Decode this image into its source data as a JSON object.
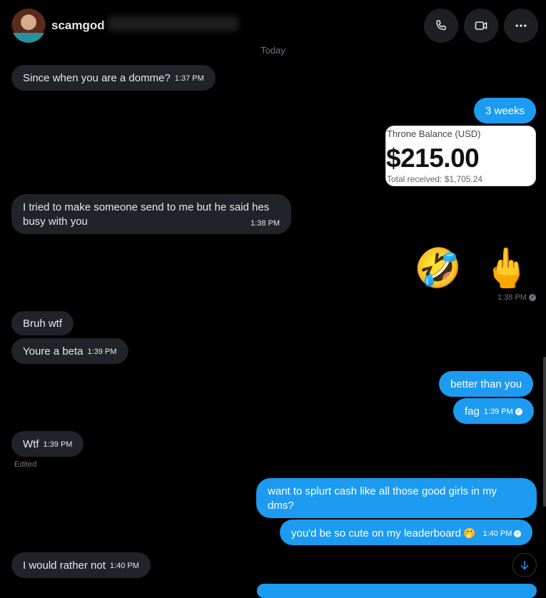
{
  "header": {
    "contact_name": "scamgod",
    "icons": [
      "phone-icon",
      "video-camera-icon",
      "more-icon"
    ]
  },
  "date_separator": "Today",
  "messages": {
    "m1": {
      "text": "Since when you are a domme?",
      "time": "1:37 PM"
    },
    "m2": {
      "text": "3 weeks"
    },
    "card": {
      "title": "Throne Balance (USD)",
      "amount": "$215.00",
      "total": "Total received: $1,705.24"
    },
    "m3": {
      "line1": "I tried to make someone send to me but he said hes",
      "line2": "busy with you",
      "time": "1:38 PM"
    },
    "emojis": {
      "e1": "🤣",
      "e2": "🖕",
      "time": "1:38 PM"
    },
    "m4": {
      "text": "Bruh wtf"
    },
    "m5": {
      "text": "Youre a beta",
      "time": "1:39 PM"
    },
    "m6": {
      "text": "better than you"
    },
    "m7": {
      "text": "fag",
      "time": "1:39 PM"
    },
    "m8": {
      "text": "Wtf",
      "time": "1:39 PM",
      "status": "Edited"
    },
    "m9": {
      "line1": "want to splurt cash like all those good girls in my",
      "line2": "dms?"
    },
    "m10": {
      "text": "you'd be so cute on my leaderboard",
      "emoji": "🤭",
      "time": "1:40 PM"
    },
    "m11": {
      "text": "I would rather not",
      "time": "1:40 PM"
    }
  },
  "colors": {
    "background": "#000000",
    "incoming_bubble": "#202327",
    "outgoing_bubble": "#1d9bf0",
    "muted_text": "#71767b"
  }
}
